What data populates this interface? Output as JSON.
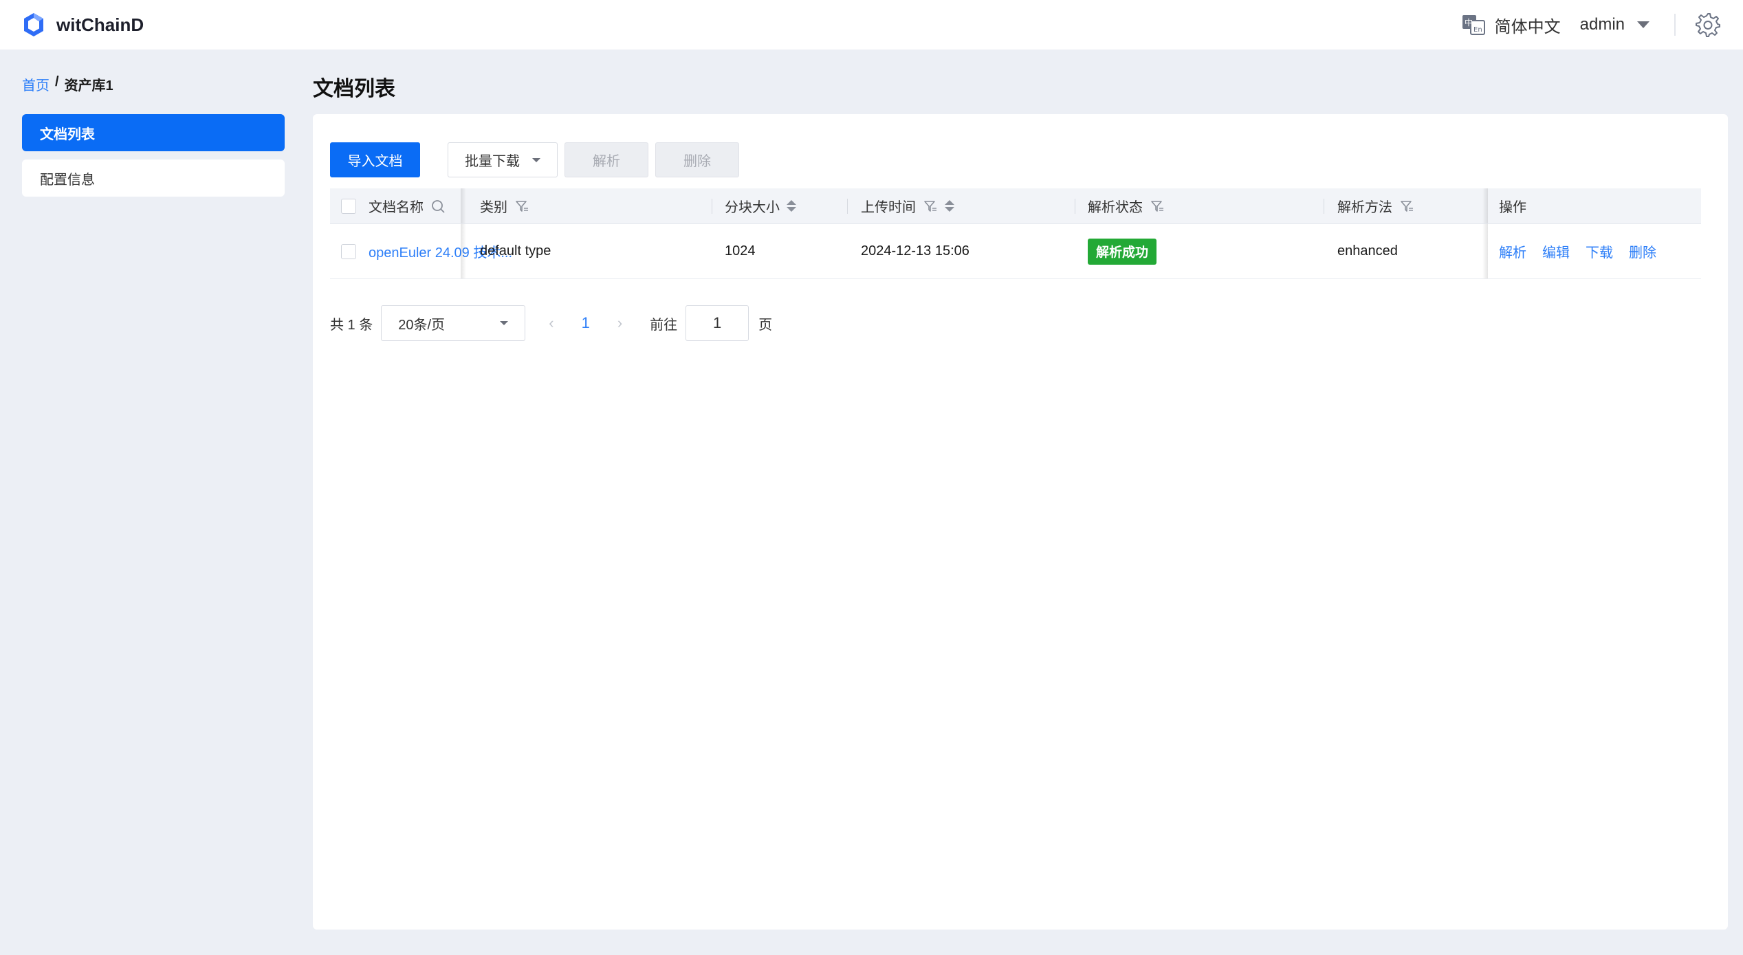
{
  "header": {
    "brand": "witChainD",
    "language": "简体中文",
    "user": "admin"
  },
  "breadcrumb": {
    "home": "首页",
    "separator": "/",
    "current": "资产库1"
  },
  "sidebar": {
    "items": [
      {
        "label": "文档列表",
        "active": true
      },
      {
        "label": "配置信息",
        "active": false
      }
    ]
  },
  "main": {
    "title": "文档列表",
    "toolbar": {
      "import": "导入文档",
      "batch_download": "批量下载",
      "parse": "解析",
      "delete": "删除"
    },
    "table": {
      "columns": {
        "name": "文档名称",
        "category": "类别",
        "chunk_size": "分块大小",
        "upload_time": "上传时间",
        "parse_status": "解析状态",
        "parse_method": "解析方法",
        "actions": "操作"
      },
      "rows": [
        {
          "name": "openEuler 24.09 技术...",
          "category": "default type",
          "chunk_size": "1024",
          "upload_time": "2024-12-13 15:06",
          "parse_status": "解析成功",
          "parse_method": "enhanced",
          "actions": {
            "parse": "解析",
            "edit": "编辑",
            "download": "下载",
            "delete": "删除"
          }
        }
      ]
    },
    "pagination": {
      "total": "共 1 条",
      "page_size": "20条/页",
      "current_page": "1",
      "prev": "‹",
      "next": "›",
      "goto_label": "前往",
      "goto_value": "1",
      "page_unit": "页"
    }
  },
  "colors": {
    "primary": "#0a6cf5",
    "link": "#2c7ef8",
    "success": "#23a936",
    "background": "#eceff5"
  },
  "icons": [
    "logo-icon",
    "language-icon",
    "chevron-down-icon",
    "gear-icon",
    "search-icon",
    "filter-icon",
    "sort-icon"
  ]
}
